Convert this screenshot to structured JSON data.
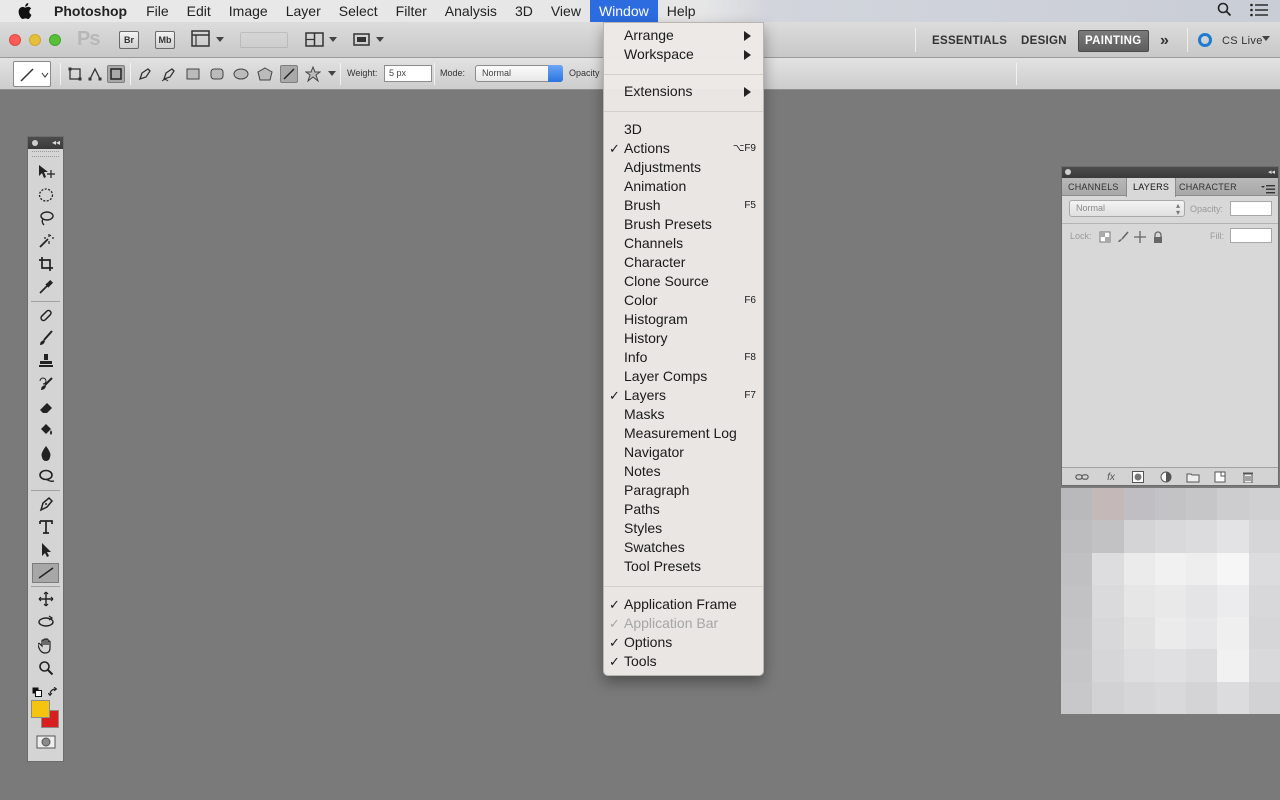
{
  "menubar": {
    "app_name": "Photoshop",
    "menus": [
      "File",
      "Edit",
      "Image",
      "Layer",
      "Select",
      "Filter",
      "Analysis",
      "3D",
      "View",
      "Window",
      "Help"
    ],
    "active_menu": "Window"
  },
  "appbar": {
    "logo": "Ps",
    "bridge_label": "Br",
    "minibridge_label": "Mb",
    "workspaces": [
      "ESSENTIALS",
      "DESIGN",
      "PAINTING"
    ],
    "selected_workspace": "PAINTING",
    "more_label": "»",
    "cs_live": "CS Live"
  },
  "options": {
    "weight_label": "Weight:",
    "weight_value": "5 px",
    "mode_label": "Mode:",
    "mode_value": "Normal",
    "opacity_label": "Opacity"
  },
  "window_menu": {
    "items": [
      {
        "label": "Arrange",
        "check": "",
        "shortcut": "",
        "submenu": true,
        "disabled": false
      },
      {
        "label": "Workspace",
        "check": "",
        "shortcut": "",
        "submenu": true,
        "disabled": false
      },
      {
        "label": "Extensions",
        "check": "",
        "shortcut": "",
        "submenu": true,
        "disabled": false
      },
      {
        "label": "3D",
        "check": "",
        "shortcut": "",
        "submenu": false,
        "disabled": false
      },
      {
        "label": "Actions",
        "check": "✓",
        "shortcut": "⌥F9",
        "submenu": false,
        "disabled": false
      },
      {
        "label": "Adjustments",
        "check": "",
        "shortcut": "",
        "submenu": false,
        "disabled": false
      },
      {
        "label": "Animation",
        "check": "",
        "shortcut": "",
        "submenu": false,
        "disabled": false
      },
      {
        "label": "Brush",
        "check": "",
        "shortcut": "F5",
        "submenu": false,
        "disabled": false
      },
      {
        "label": "Brush Presets",
        "check": "",
        "shortcut": "",
        "submenu": false,
        "disabled": false
      },
      {
        "label": "Channels",
        "check": "",
        "shortcut": "",
        "submenu": false,
        "disabled": false
      },
      {
        "label": "Character",
        "check": "",
        "shortcut": "",
        "submenu": false,
        "disabled": false
      },
      {
        "label": "Clone Source",
        "check": "",
        "shortcut": "",
        "submenu": false,
        "disabled": false
      },
      {
        "label": "Color",
        "check": "",
        "shortcut": "F6",
        "submenu": false,
        "disabled": false
      },
      {
        "label": "Histogram",
        "check": "",
        "shortcut": "",
        "submenu": false,
        "disabled": false
      },
      {
        "label": "History",
        "check": "",
        "shortcut": "",
        "submenu": false,
        "disabled": false
      },
      {
        "label": "Info",
        "check": "",
        "shortcut": "F8",
        "submenu": false,
        "disabled": false
      },
      {
        "label": "Layer Comps",
        "check": "",
        "shortcut": "",
        "submenu": false,
        "disabled": false
      },
      {
        "label": "Layers",
        "check": "✓",
        "shortcut": "F7",
        "submenu": false,
        "disabled": false
      },
      {
        "label": "Masks",
        "check": "",
        "shortcut": "",
        "submenu": false,
        "disabled": false
      },
      {
        "label": "Measurement Log",
        "check": "",
        "shortcut": "",
        "submenu": false,
        "disabled": false
      },
      {
        "label": "Navigator",
        "check": "",
        "shortcut": "",
        "submenu": false,
        "disabled": false
      },
      {
        "label": "Notes",
        "check": "",
        "shortcut": "",
        "submenu": false,
        "disabled": false
      },
      {
        "label": "Paragraph",
        "check": "",
        "shortcut": "",
        "submenu": false,
        "disabled": false
      },
      {
        "label": "Paths",
        "check": "",
        "shortcut": "",
        "submenu": false,
        "disabled": false
      },
      {
        "label": "Styles",
        "check": "",
        "shortcut": "",
        "submenu": false,
        "disabled": false
      },
      {
        "label": "Swatches",
        "check": "",
        "shortcut": "",
        "submenu": false,
        "disabled": false
      },
      {
        "label": "Tool Presets",
        "check": "",
        "shortcut": "",
        "submenu": false,
        "disabled": false
      },
      {
        "label": "Application Frame",
        "check": "✓",
        "shortcut": "",
        "submenu": false,
        "disabled": false
      },
      {
        "label": "Application Bar",
        "check": "✓",
        "shortcut": "",
        "submenu": false,
        "disabled": true
      },
      {
        "label": "Options",
        "check": "✓",
        "shortcut": "",
        "submenu": false,
        "disabled": false
      },
      {
        "label": "Tools",
        "check": "✓",
        "shortcut": "",
        "submenu": false,
        "disabled": false
      }
    ]
  },
  "layers_panel": {
    "tabs": [
      "CHANNELS",
      "LAYERS",
      "CHARACTER"
    ],
    "active_tab": "LAYERS",
    "blend_mode": "Normal",
    "opacity_label": "Opacity:",
    "lock_label": "Lock:",
    "fill_label": "Fill:"
  },
  "tools": {
    "foreground_color": "#f5c40e",
    "background_color": "#d71f1f"
  },
  "colors": {
    "menu_highlight": "#2c6ce0",
    "workspace_bg": "#7a7a7a"
  }
}
